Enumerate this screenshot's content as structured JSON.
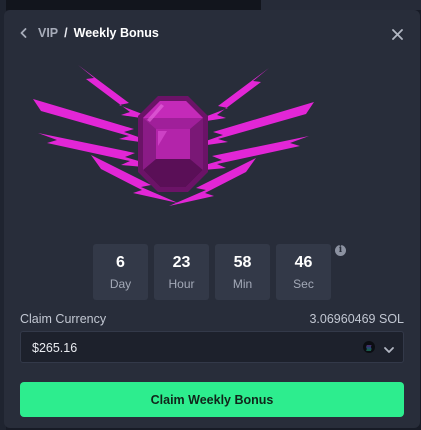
{
  "breadcrumb": {
    "parent": "VIP",
    "separator": "/",
    "current": "Weekly Bonus"
  },
  "icons": {
    "back": "chevron-left-icon",
    "close": "close-icon",
    "info": "info-icon",
    "currency": "solana-icon",
    "dropdown": "chevron-down-icon"
  },
  "countdown": [
    {
      "value": "6",
      "unit": "Day"
    },
    {
      "value": "23",
      "unit": "Hour"
    },
    {
      "value": "58",
      "unit": "Min"
    },
    {
      "value": "46",
      "unit": "Sec"
    }
  ],
  "claim": {
    "label": "Claim Currency",
    "amount": "3.06960469 SOL",
    "selected_value": "$265.16",
    "button_label": "Claim Weekly Bonus"
  },
  "colors": {
    "modal_bg": "#282d3a",
    "accent_green": "#2ded8e",
    "gem_magenta": "#e226d6",
    "gem_dark": "#5a0f57"
  }
}
